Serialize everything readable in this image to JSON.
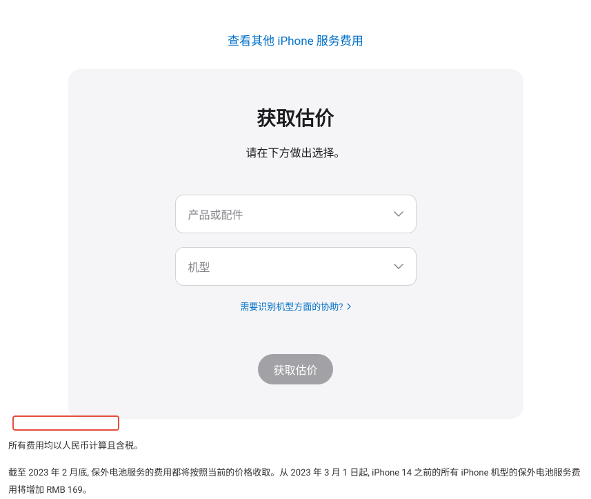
{
  "top_link": "查看其他 iPhone 服务费用",
  "card": {
    "title": "获取估价",
    "subtitle": "请在下方做出选择。",
    "product_placeholder": "产品或配件",
    "model_placeholder": "机型",
    "help_link": "需要识别机型方面的协助?",
    "button_label": "获取估价"
  },
  "footer": {
    "line1": "所有费用均以人民币计算且含税。",
    "line2": "截至 2023 年 2 月底, 保外电池服务的费用都将按照当前的价格收取。从 2023 年 3 月 1 日起, iPhone 14 之前的所有 iPhone 机型的保外电池服务费用将增加 RMB 169。"
  }
}
